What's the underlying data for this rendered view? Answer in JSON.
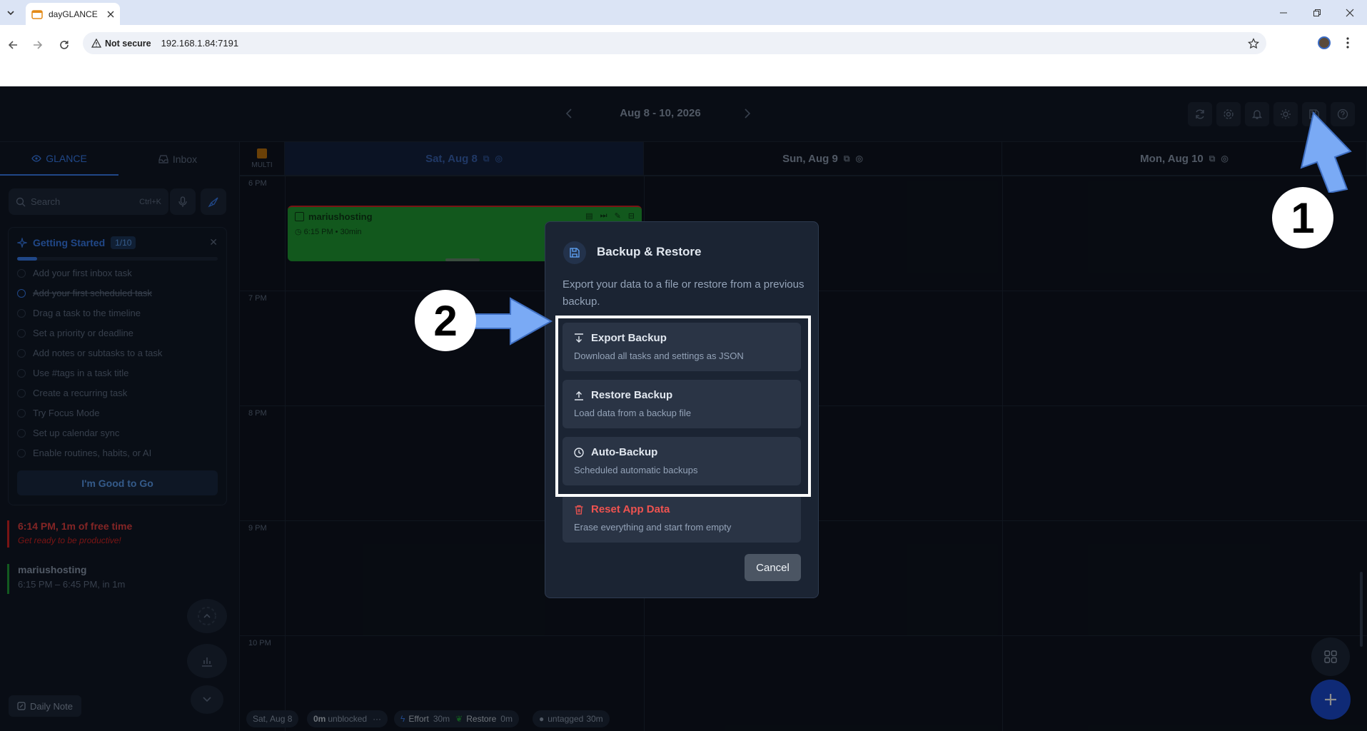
{
  "browser": {
    "tab_title": "dayGLANCE",
    "not_secure": "Not secure",
    "url": "192.168.1.84:7191"
  },
  "header": {
    "date_range": "Aug 8 - 10, 2026",
    "buttons": [
      "refresh-icon",
      "gear-icon",
      "bell-icon",
      "sun-icon",
      "save-icon",
      "help-icon"
    ]
  },
  "sidebar": {
    "tab_glance": "GLANCE",
    "tab_inbox": "Inbox",
    "search_placeholder": "Search",
    "search_shortcut": "Ctrl+K",
    "getting_started": {
      "title": "Getting Started",
      "count": "1/10",
      "progress": 0.1,
      "items": [
        {
          "label": "Add your first inbox task",
          "done": false
        },
        {
          "label": "Add your first scheduled task",
          "done": true
        },
        {
          "label": "Drag a task to the timeline",
          "done": false
        },
        {
          "label": "Set a priority or deadline",
          "done": false
        },
        {
          "label": "Add notes or subtasks to a task",
          "done": false
        },
        {
          "label": "Use #tags in a task title",
          "done": false
        },
        {
          "label": "Create a recurring task",
          "done": false
        },
        {
          "label": "Try Focus Mode",
          "done": false
        },
        {
          "label": "Set up calendar sync",
          "done": false
        },
        {
          "label": "Enable routines, habits, or AI",
          "done": false
        }
      ],
      "button": "I'm Good to Go"
    },
    "free_time": {
      "title": "6:14 PM, 1m of free time",
      "subtitle": "Get ready to be productive!"
    },
    "upcoming": {
      "title": "mariushosting",
      "subtitle": "6:15 PM – 6:45 PM, in 1m"
    },
    "daily_note": "Daily Note"
  },
  "calendar": {
    "multi_label": "MULTI",
    "days": [
      "Sat, Aug 8",
      "Sun, Aug 9",
      "Mon, Aug 10"
    ],
    "hours": [
      "6 PM",
      "7 PM",
      "8 PM",
      "9 PM",
      "10 PM"
    ],
    "event": {
      "title": "mariushosting",
      "time": "6:15 PM • 30min"
    }
  },
  "status_bar": {
    "date": "Sat, Aug 8",
    "unblocked_value": "0m",
    "unblocked_label": "unblocked",
    "more": "···",
    "effort_label": "Effort",
    "effort_value": "30m",
    "restore_label": "Restore",
    "restore_value": "0m",
    "untagged_label": "untagged",
    "untagged_value": "30m"
  },
  "modal": {
    "title": "Backup & Restore",
    "description": "Export your data to a file or restore from a previous backup.",
    "options": [
      {
        "title": "Export Backup",
        "subtitle": "Download all tasks and settings as JSON",
        "icon": "download-icon"
      },
      {
        "title": "Restore Backup",
        "subtitle": "Load data from a backup file",
        "icon": "upload-icon"
      },
      {
        "title": "Auto-Backup",
        "subtitle": "Scheduled automatic backups",
        "icon": "clock-icon"
      },
      {
        "title": "Reset App Data",
        "subtitle": "Erase everything and start from empty",
        "icon": "trash-icon"
      }
    ],
    "cancel": "Cancel"
  },
  "annotations": {
    "step1": "1",
    "step2": "2"
  },
  "colors": {
    "accent": "#3b82f6",
    "event": "#21a136",
    "danger": "#ef5350",
    "arrow": "#7aaaf5"
  }
}
